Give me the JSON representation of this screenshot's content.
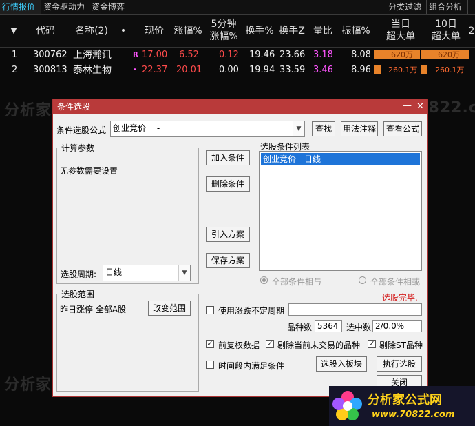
{
  "tabs": [
    "行情报价",
    "资金驱动力",
    "资金博弈",
    "分类过滤",
    "组合分析"
  ],
  "columns": {
    "sort_arrow": "▼",
    "code": "代码",
    "name": "名称(2)",
    "dot": "•",
    "price": "现价",
    "change": "涨幅%",
    "five_min_1": "5分钟",
    "five_min_2": "涨幅%",
    "turnover": "换手%",
    "turnover_z": "换手Z",
    "volume_ratio": "量比",
    "amplitude": "振幅%",
    "day_big_1": "当日",
    "day_big_2": "超大单",
    "ten_big_1": "10日",
    "ten_big_2": "超大单",
    "more": "2"
  },
  "rows": [
    {
      "idx": "1",
      "code": "300762",
      "name": "上海瀚讯",
      "flag": "R",
      "price": "17.00",
      "change": "6.52",
      "five_min": "0.12",
      "turnover": "19.46",
      "turnover_z": "23.66",
      "volume_ratio": "3.18",
      "amplitude": "8.08",
      "day_big": "620万",
      "ten_big": "620万",
      "day_fill": 1.0,
      "ten_fill": 1.0
    },
    {
      "idx": "2",
      "code": "300813",
      "name": "泰林生物",
      "flag": "•",
      "price": "22.37",
      "change": "20.01",
      "five_min": "0.00",
      "turnover": "19.94",
      "turnover_z": "33.59",
      "volume_ratio": "3.46",
      "amplitude": "8.96",
      "day_big": "260.1万",
      "ten_big": "260.1万",
      "day_fill": 0.13,
      "ten_fill": 0.13
    }
  ],
  "watermark": "分析家公式网www.70822.com",
  "dialog": {
    "title": "条件选股",
    "min": "—",
    "close": "✕",
    "formula_label": "条件选股公式",
    "formula_value": "创业竞价　 -",
    "find_btn": "查找",
    "usage_btn": "用法注释",
    "view_btn": "查看公式",
    "calc_params": "计算参数",
    "no_params": "无参数需要设置",
    "add_cond": "加入条件",
    "del_cond": "删除条件",
    "import_plan": "引入方案",
    "save_plan": "保存方案",
    "cond_list_title": "选股条件列表",
    "cond_item": "创业竞价　日线",
    "period_label": "选股周期:",
    "period_value": "日线",
    "radio_and": "全部条件相与",
    "radio_or": "全部条件相或",
    "status": "选股完毕.",
    "range_title": "选股范围",
    "range_value": "昨日涨停 全部A股",
    "change_range": "改变范围",
    "use_period": "使用涨跌不定周期",
    "count_label": "品种数",
    "count_value": "5364",
    "selected_label": "选中数",
    "selected_value": "2/0.0%",
    "pre_adjust": "前复权数据",
    "skip_untraded": "剔除当前未交易的品种",
    "skip_st": "剔除ST品种",
    "time_range": "时间段内满足条件",
    "to_block": "选股入板块",
    "run": "执行选股",
    "close_btn": "关闭"
  },
  "logo": {
    "title": "分析家公式网",
    "url": "www.70822.com"
  }
}
